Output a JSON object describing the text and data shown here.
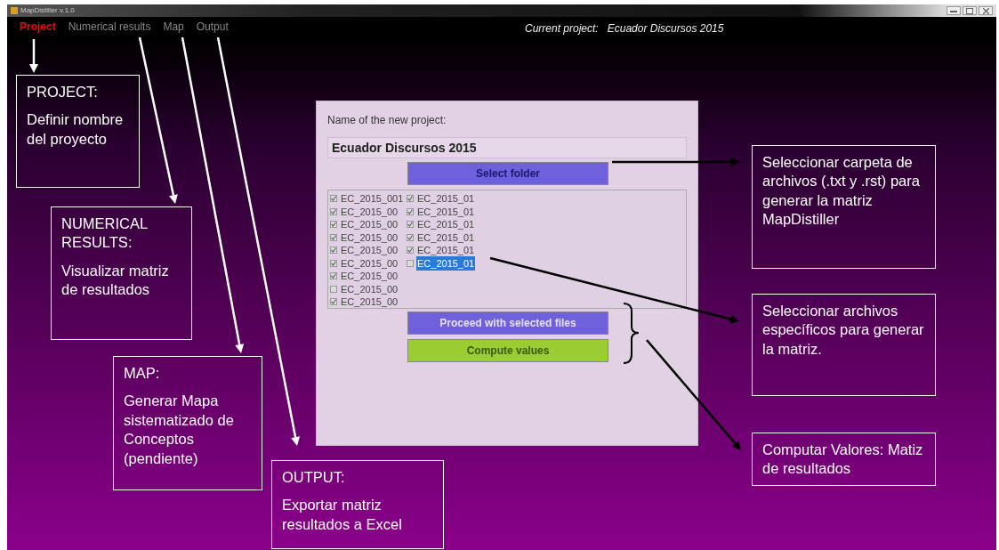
{
  "window": {
    "title": "MapDistiller v.1.0"
  },
  "menu": [
    {
      "label": "Project",
      "selected": true
    },
    {
      "label": "Numerical results",
      "selected": false
    },
    {
      "label": "Map",
      "selected": false
    },
    {
      "label": "Output",
      "selected": false
    }
  ],
  "current_project": {
    "label": "Current project:",
    "value": "Ecuador Discursos 2015"
  },
  "panel": {
    "name_label": "Name of the new project:",
    "project_name": "Ecuador Discursos 2015",
    "select_button": "Select folder",
    "files": [
      {
        "name": "EC_2015_001",
        "checked": true,
        "selected": false
      },
      {
        "name": "EC_2015_00",
        "checked": true,
        "selected": false
      },
      {
        "name": "EC_2015_00",
        "checked": true,
        "selected": false
      },
      {
        "name": "EC_2015_00",
        "checked": true,
        "selected": false
      },
      {
        "name": "EC_2015_00",
        "checked": true,
        "selected": false
      },
      {
        "name": "EC_2015_00",
        "checked": true,
        "selected": false
      },
      {
        "name": "EC_2015_00",
        "checked": true,
        "selected": false
      },
      {
        "name": "EC_2015_00",
        "checked": false,
        "selected": false
      },
      {
        "name": "EC_2015_00",
        "checked": true,
        "selected": false
      },
      {
        "name": "EC_2015_01",
        "checked": true,
        "selected": false
      },
      {
        "name": "EC_2015_01",
        "checked": true,
        "selected": false
      },
      {
        "name": "EC_2015_01",
        "checked": true,
        "selected": false
      },
      {
        "name": "EC_2015_01",
        "checked": true,
        "selected": false
      },
      {
        "name": "EC_2015_01",
        "checked": true,
        "selected": false
      },
      {
        "name": "EC_2015_01",
        "checked": false,
        "selected": true
      }
    ],
    "proceed_button": "Proceed with selected files",
    "compute_button": "Compute values"
  },
  "callouts": [
    {
      "heading": "PROJECT:",
      "body": "Definir nombre del proyecto"
    },
    {
      "heading": "NUMERICAL RESULTS:",
      "body": "Visualizar matriz de resultados"
    },
    {
      "heading": "MAP:",
      "body": "Generar Mapa sistematizado de Conceptos (pendiente)"
    },
    {
      "heading": "OUTPUT:",
      "body": "Exportar matriz resultados a Excel"
    },
    {
      "body": "Seleccionar carpeta de archivos (.txt y .rst) para generar la matriz MapDistiller"
    },
    {
      "body": "Seleccionar archivos específicos para generar la matriz."
    },
    {
      "body": "Computar Valores: Matiz de resultados"
    }
  ]
}
